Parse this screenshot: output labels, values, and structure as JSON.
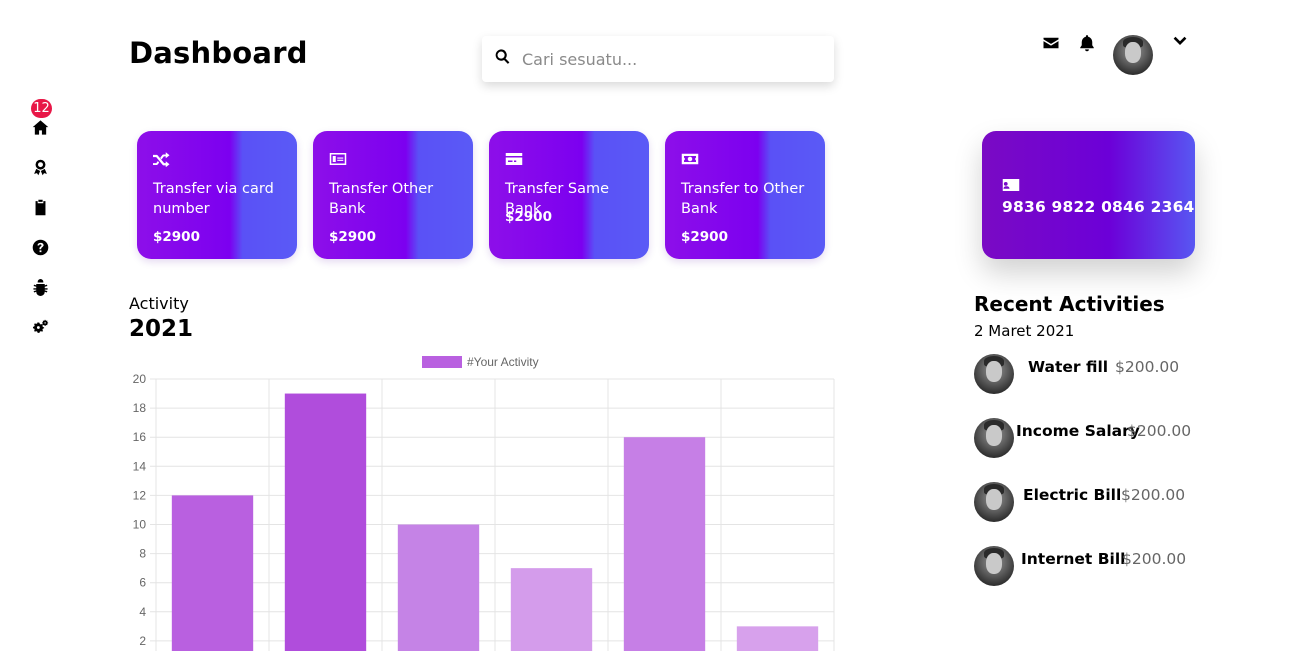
{
  "header": {
    "title": "Dashboard",
    "search_placeholder": "Cari sesuatu..."
  },
  "sidebar": {
    "badge_count": "12",
    "items": [
      {
        "icon": "home-icon"
      },
      {
        "icon": "award-icon"
      },
      {
        "icon": "clipboard-icon"
      },
      {
        "icon": "question-icon"
      },
      {
        "icon": "bug-icon"
      },
      {
        "icon": "gears-icon"
      }
    ]
  },
  "top_icons": [
    "envelope-icon",
    "bell-icon",
    "chevron-down-icon"
  ],
  "cards": [
    {
      "icon": "shuffle-icon",
      "label": "Transfer via card number",
      "amount": "$2900"
    },
    {
      "icon": "money-card-icon",
      "label": "Transfer Other Bank",
      "amount": "$2900"
    },
    {
      "icon": "credit-card-icon",
      "label": "Transfer Same Bank",
      "amount": "$2900"
    },
    {
      "icon": "money-bill-icon",
      "label": "Transfer to Other Bank",
      "amount": "$2900"
    }
  ],
  "bank_card": {
    "icon": "id-card-icon",
    "number": "9836 9822 0846 2364"
  },
  "activity": {
    "label": "Activity",
    "year": "2021"
  },
  "chart_data": {
    "type": "bar",
    "legend": "#Your Activity",
    "legend_placement": "top",
    "grid": true,
    "values": [
      12,
      19,
      10,
      7,
      16,
      3
    ],
    "y_ticks": [
      2,
      4,
      6,
      8,
      10,
      12,
      14,
      16,
      18,
      20
    ],
    "ylim": [
      0,
      20
    ],
    "colors": [
      "#b960e0",
      "#b04ddc",
      "#c583e6",
      "#d49ceb",
      "#c67fe6",
      "#d7a1ec"
    ]
  },
  "recent": {
    "title": "Recent Activities",
    "date": "2 Maret 2021",
    "items": [
      {
        "name": "Water fill",
        "amount": "$200.00"
      },
      {
        "name": "Income Salary",
        "amount": "$200.00"
      },
      {
        "name": "Electric Bill",
        "amount": "$200.00"
      },
      {
        "name": "Internet Bill",
        "amount": "$200.00"
      }
    ]
  }
}
